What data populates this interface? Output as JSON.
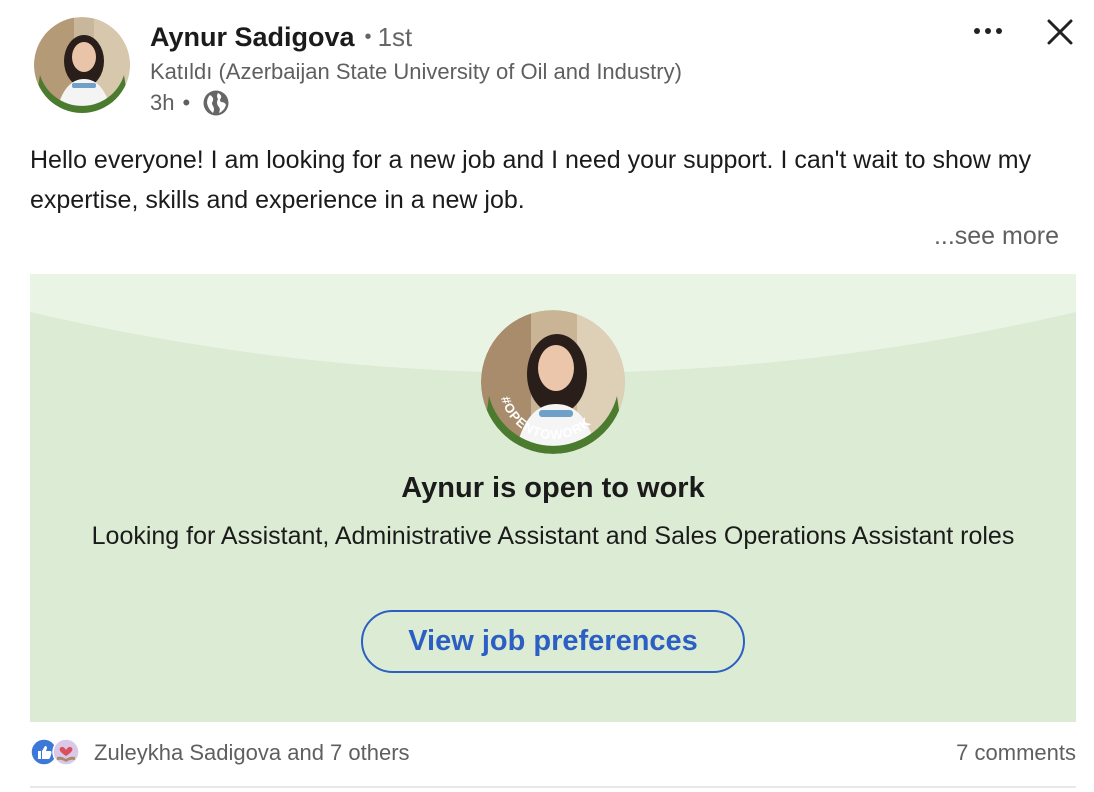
{
  "author": {
    "name": "Aynur Sadigova",
    "separator": "•",
    "degree": "1st",
    "headline": "Katıldı (Azerbaijan State University of Oil and Industry)",
    "time": "3h",
    "time_separator": "•",
    "visibility_icon": "globe-icon",
    "avatar_ring_text": "#OPENTOWORK"
  },
  "actions": {
    "more_icon": "ellipsis-icon",
    "close_icon": "close-icon"
  },
  "post": {
    "text": "Hello everyone! I am looking for a new job and I need your support. I can't wait to show my expertise, skills and experience in a new job.",
    "see_more": "...see more"
  },
  "open_to_work": {
    "title": "Aynur is open to work",
    "description": "Looking for Assistant, Administrative Assistant and Sales Operations Assistant roles",
    "button_label": "View job preferences",
    "ring_text": "#OPENTOWORK"
  },
  "social": {
    "reactions": [
      "like-icon",
      "support-icon"
    ],
    "reactors_text": "Zuleykha Sadigova and 7 others",
    "comments_text": "7 comments"
  },
  "colors": {
    "card_bg": "#dcebd3",
    "card_curve": "#eaf4e4",
    "ring_green": "#4b7b2f",
    "link_blue": "#2b5fc4"
  }
}
